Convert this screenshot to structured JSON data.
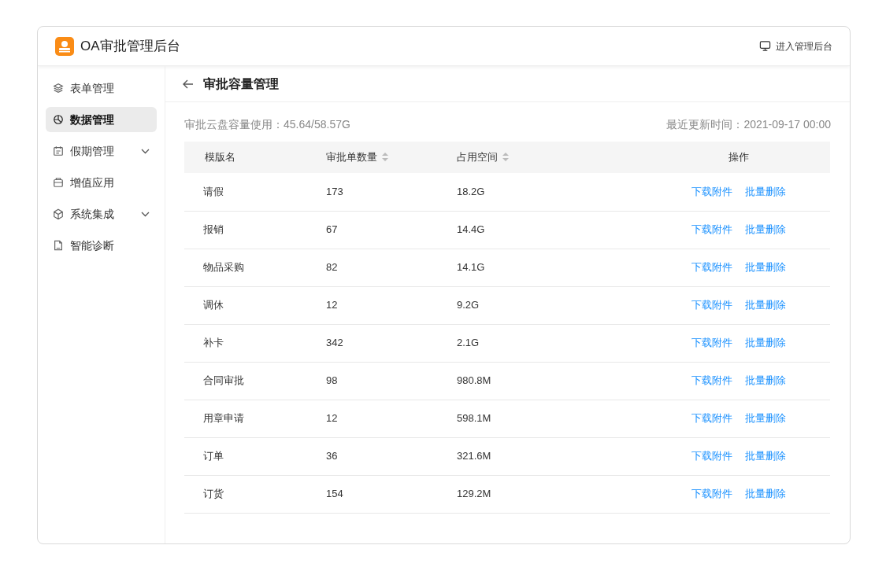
{
  "header": {
    "title": "OA审批管理后台",
    "admin_link": "进入管理后台"
  },
  "sidebar": {
    "items": [
      {
        "label": "表单管理",
        "selected": false,
        "expandable": false
      },
      {
        "label": "数据管理",
        "selected": true,
        "expandable": false
      },
      {
        "label": "假期管理",
        "selected": false,
        "expandable": true
      },
      {
        "label": "增值应用",
        "selected": false,
        "expandable": false
      },
      {
        "label": "系统集成",
        "selected": false,
        "expandable": true
      },
      {
        "label": "智能诊断",
        "selected": false,
        "expandable": false
      }
    ]
  },
  "page": {
    "title": "审批容量管理",
    "usage": "审批云盘容量使用：45.64/58.57G",
    "updated": "最近更新时间：2021-09-17 00:00"
  },
  "table": {
    "columns": [
      {
        "label": "模版名",
        "sortable": false
      },
      {
        "label": "审批单数量",
        "sortable": true
      },
      {
        "label": "占用空间",
        "sortable": true
      },
      {
        "label": "操作",
        "sortable": false
      }
    ],
    "rows": [
      {
        "name": "请假",
        "count": "173",
        "size": "18.2G",
        "actions": [
          "下载附件",
          "批量删除"
        ]
      },
      {
        "name": "报销",
        "count": "67",
        "size": "14.4G",
        "actions": [
          "下载附件",
          "批量删除"
        ]
      },
      {
        "name": "物品采购",
        "count": "82",
        "size": "14.1G",
        "actions": [
          "下载附件",
          "批量删除"
        ]
      },
      {
        "name": "调休",
        "count": "12",
        "size": "9.2G",
        "actions": [
          "下载附件",
          "批量删除"
        ]
      },
      {
        "name": "补卡",
        "count": "342",
        "size": "2.1G",
        "actions": [
          "下载附件",
          "批量删除"
        ]
      },
      {
        "name": "合同审批",
        "count": "98",
        "size": "980.8M",
        "actions": [
          "下载附件",
          "批量删除"
        ]
      },
      {
        "name": "用章申请",
        "count": "12",
        "size": "598.1M",
        "actions": [
          "下载附件",
          "批量删除"
        ]
      },
      {
        "name": "订单",
        "count": "36",
        "size": "321.6M",
        "actions": [
          "下载附件",
          "批量删除"
        ]
      },
      {
        "name": "订货",
        "count": "154",
        "size": "129.2M",
        "actions": [
          "下载附件",
          "批量删除"
        ]
      }
    ]
  }
}
